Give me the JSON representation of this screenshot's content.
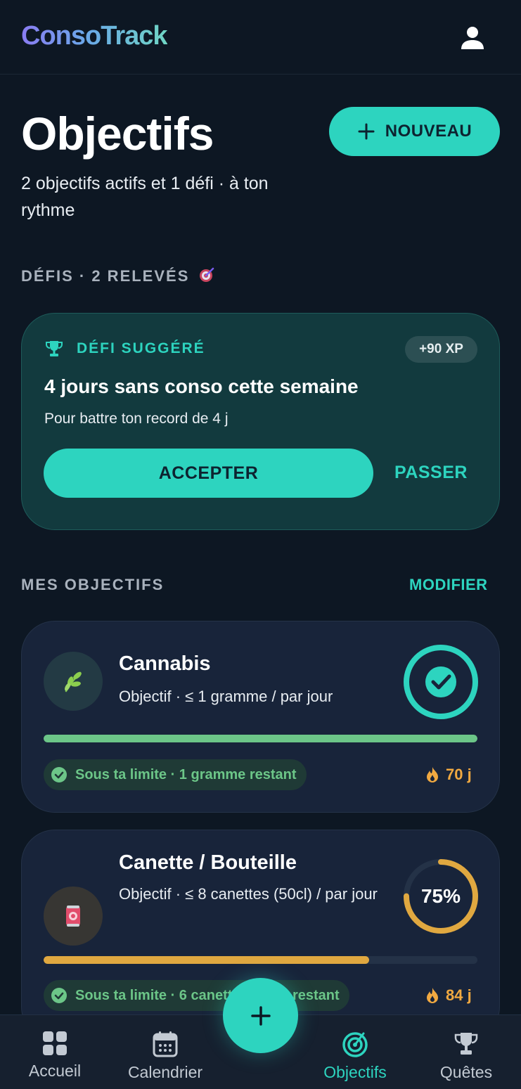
{
  "header": {
    "app_name": "ConsoTrack",
    "profile_icon": "user-icon"
  },
  "page": {
    "title": "Objectifs",
    "new_button": "NOUVEAU",
    "subtitle": "2 objectifs actifs et 1 défi · à ton rythme"
  },
  "defis": {
    "section_label": "DÉFIS · 2 RELEVÉS",
    "section_icon": "target-icon",
    "card": {
      "tag": "DÉFI SUGGÉRÉ",
      "xp": "+90 XP",
      "title": "4 jours sans conso cette semaine",
      "description": "Pour battre ton record de 4 j",
      "accept_label": "ACCEPTER",
      "skip_label": "PASSER"
    }
  },
  "goals": {
    "section_label": "MES OBJECTIFS",
    "edit_label": "MODIFIER",
    "items": [
      {
        "name": "Cannabis",
        "target": "Objectif · ≤ 1 gramme / par jour",
        "icon": "leaf-icon",
        "progress": 1.0,
        "ring_state": "check",
        "status": "Sous ta limite · 1 gramme restant",
        "streak": "70 j",
        "color": "#6cc688"
      },
      {
        "name": "Canette / Bouteille",
        "target": "Objectif · ≤ 8 canettes (50cl) / par jour",
        "icon": "can-icon",
        "progress": 0.75,
        "ring_label": "75%",
        "status": "Sous ta limite · 6 canettes (50cl) restant",
        "streak": "84 j",
        "color": "#e0a840"
      }
    ]
  },
  "nav": {
    "items": [
      {
        "label": "Accueil",
        "icon": "grid-icon"
      },
      {
        "label": "Calendrier",
        "icon": "calendar-icon"
      },
      {
        "label": "Objectifs",
        "icon": "target-icon"
      },
      {
        "label": "Quêtes",
        "icon": "trophy-icon"
      }
    ],
    "fab_icon": "plus-icon"
  },
  "colors": {
    "accent": "#2dd4bf",
    "background": "#0d1723",
    "card": "#18243a",
    "success": "#6cc688",
    "warning": "#e0a840",
    "streak": "#f1a941"
  }
}
